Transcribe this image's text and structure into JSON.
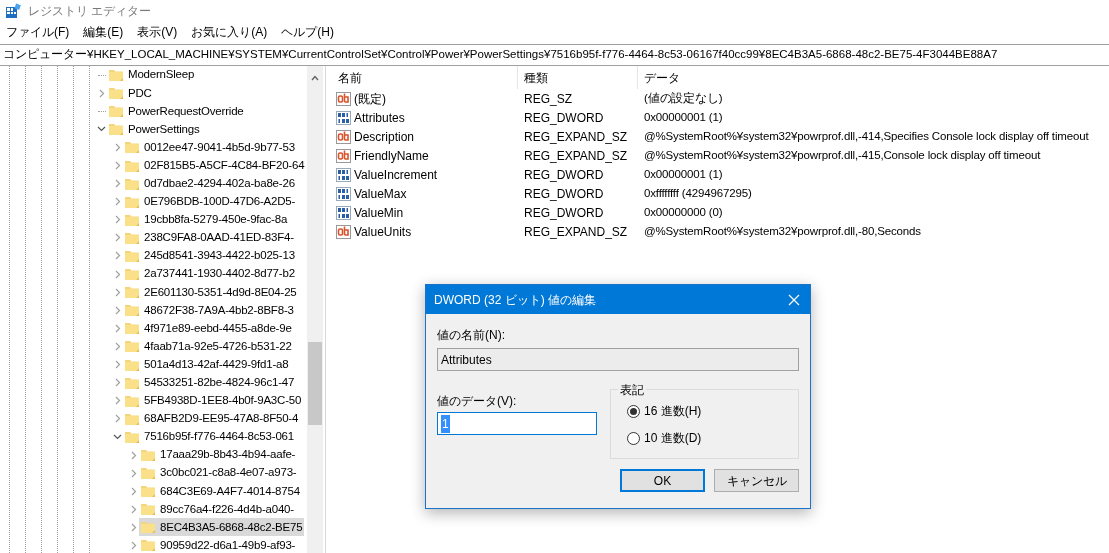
{
  "window": {
    "title": "レジストリ エディター"
  },
  "menu": [
    "ファイル(F)",
    "編集(E)",
    "表示(V)",
    "お気に入り(A)",
    "ヘルプ(H)"
  ],
  "address": "コンピューター¥HKEY_LOCAL_MACHINE¥SYSTEM¥CurrentControlSet¥Control¥Power¥PowerSettings¥7516b95f-f776-4464-8c53-06167f40cc99¥8EC4B3A5-6868-48c2-BE75-4F3044BE88A7",
  "tree": [
    {
      "label": "ModernSleep",
      "has_children": false,
      "selected": false
    },
    {
      "label": "PDC",
      "has_children": true,
      "expanded": false,
      "selected": false
    },
    {
      "label": "PowerRequestOverride",
      "has_children": false,
      "selected": false
    },
    {
      "label": "PowerSettings",
      "has_children": true,
      "expanded": true,
      "selected": false,
      "children": [
        {
          "label": "0012ee47-9041-4b5d-9b77-53",
          "has_children": true,
          "expanded": false,
          "selected": false
        },
        {
          "label": "02F815B5-A5CF-4C84-BF20-64",
          "has_children": true,
          "expanded": false,
          "selected": false
        },
        {
          "label": "0d7dbae2-4294-402a-ba8e-26",
          "has_children": true,
          "expanded": false,
          "selected": false
        },
        {
          "label": "0E796BDB-100D-47D6-A2D5-",
          "has_children": true,
          "expanded": false,
          "selected": false
        },
        {
          "label": "19cbb8fa-5279-450e-9fac-8a",
          "has_children": true,
          "expanded": false,
          "selected": false
        },
        {
          "label": "238C9FA8-0AAD-41ED-83F4-",
          "has_children": true,
          "expanded": false,
          "selected": false
        },
        {
          "label": "245d8541-3943-4422-b025-13",
          "has_children": true,
          "expanded": false,
          "selected": false
        },
        {
          "label": "2a737441-1930-4402-8d77-b2",
          "has_children": true,
          "expanded": false,
          "selected": false
        },
        {
          "label": "2E601130-5351-4d9d-8E04-25",
          "has_children": true,
          "expanded": false,
          "selected": false
        },
        {
          "label": "48672F38-7A9A-4bb2-8BF8-3",
          "has_children": true,
          "expanded": false,
          "selected": false
        },
        {
          "label": "4f971e89-eebd-4455-a8de-9e",
          "has_children": true,
          "expanded": false,
          "selected": false
        },
        {
          "label": "4faab71a-92e5-4726-b531-22",
          "has_children": true,
          "expanded": false,
          "selected": false
        },
        {
          "label": "501a4d13-42af-4429-9fd1-a8",
          "has_children": true,
          "expanded": false,
          "selected": false
        },
        {
          "label": "54533251-82be-4824-96c1-47",
          "has_children": true,
          "expanded": false,
          "selected": false
        },
        {
          "label": "5FB4938D-1EE8-4b0f-9A3C-50",
          "has_children": true,
          "expanded": false,
          "selected": false
        },
        {
          "label": "68AFB2D9-EE95-47A8-8F50-4",
          "has_children": true,
          "expanded": false,
          "selected": false
        },
        {
          "label": "7516b95f-f776-4464-8c53-061",
          "has_children": true,
          "expanded": true,
          "selected": false,
          "children": [
            {
              "label": "17aaa29b-8b43-4b94-aafe-",
              "has_children": true,
              "expanded": false,
              "selected": false
            },
            {
              "label": "3c0bc021-c8a8-4e07-a973-",
              "has_children": true,
              "expanded": false,
              "selected": false
            },
            {
              "label": "684C3E69-A4F7-4014-8754",
              "has_children": true,
              "expanded": false,
              "selected": false
            },
            {
              "label": "89cc76a4-f226-4d4b-a040-",
              "has_children": true,
              "expanded": false,
              "selected": false
            },
            {
              "label": "8EC4B3A5-6868-48c2-BE75",
              "has_children": true,
              "expanded": false,
              "selected": true
            },
            {
              "label": "90959d22-d6a1-49b9-af93-",
              "has_children": true,
              "expanded": false,
              "selected": false
            }
          ]
        }
      ]
    }
  ],
  "table": {
    "columns": [
      "名前",
      "種類",
      "データ"
    ],
    "rows": [
      {
        "kind": "string",
        "name": "(既定)",
        "type": "REG_SZ",
        "data": "(値の設定なし)"
      },
      {
        "kind": "dword",
        "name": "Attributes",
        "type": "REG_DWORD",
        "data": "0x00000001 (1)"
      },
      {
        "kind": "string",
        "name": "Description",
        "type": "REG_EXPAND_SZ",
        "data": "@%SystemRoot%¥system32¥powrprof.dll,-414,Specifies Console lock display off timeout"
      },
      {
        "kind": "string",
        "name": "FriendlyName",
        "type": "REG_EXPAND_SZ",
        "data": "@%SystemRoot%¥system32¥powrprof.dll,-415,Console lock display off timeout"
      },
      {
        "kind": "dword",
        "name": "ValueIncrement",
        "type": "REG_DWORD",
        "data": "0x00000001 (1)"
      },
      {
        "kind": "dword",
        "name": "ValueMax",
        "type": "REG_DWORD",
        "data": "0xffffffff (4294967295)"
      },
      {
        "kind": "dword",
        "name": "ValueMin",
        "type": "REG_DWORD",
        "data": "0x00000000 (0)"
      },
      {
        "kind": "string",
        "name": "ValueUnits",
        "type": "REG_EXPAND_SZ",
        "data": "@%SystemRoot%¥system32¥powrprof.dll,-80,Seconds"
      }
    ]
  },
  "dialog": {
    "title": "DWORD (32 ビット) 値の編集",
    "name_label": "値の名前(N):",
    "name_value": "Attributes",
    "data_label": "値のデータ(V):",
    "data_value": "1",
    "base_group": "表記",
    "bases": [
      {
        "label": "16 進数(H)",
        "selected": true
      },
      {
        "label": "10 進数(D)",
        "selected": false
      }
    ],
    "buttons": [
      {
        "label": "OK",
        "default": true
      },
      {
        "label": "キャンセル",
        "default": false
      }
    ]
  }
}
